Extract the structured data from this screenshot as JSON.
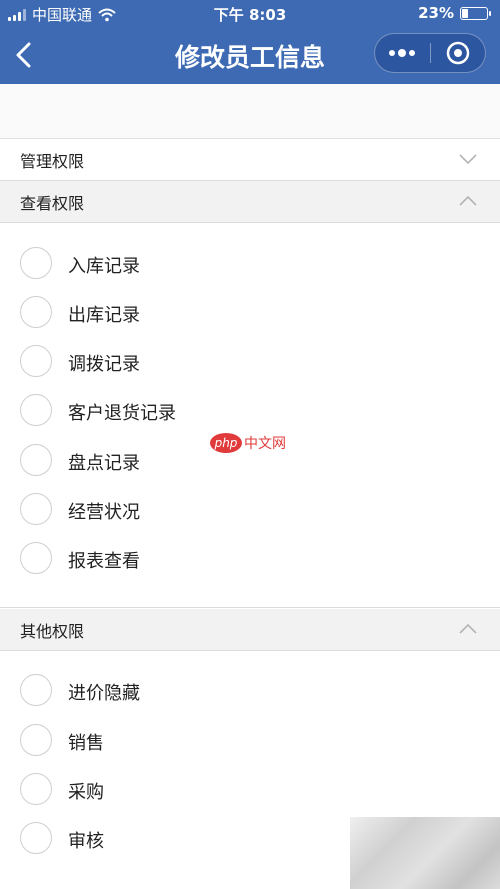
{
  "status_bar": {
    "carrier": "中国联通",
    "time": "下午 8:03",
    "battery_percent": "23%",
    "battery_level": 0.23
  },
  "nav": {
    "title": "修改员工信息",
    "back_icon": "chevron-left-icon",
    "menu_icon": "more-dots-icon",
    "close_icon": "target-circle-icon"
  },
  "sections": [
    {
      "title": "管理权限",
      "expanded": false,
      "options": []
    },
    {
      "title": "查看权限",
      "expanded": true,
      "options": [
        "入库记录",
        "出库记录",
        "调拨记录",
        "客户退货记录",
        "盘点记录",
        "经营状况",
        "报表查看"
      ]
    },
    {
      "title": "其他权限",
      "expanded": true,
      "options": [
        "进价隐藏",
        "销售",
        "采购",
        "审核"
      ]
    }
  ],
  "watermark": {
    "logo": "php",
    "text": "中文网"
  },
  "colors": {
    "nav_bg": "#3d6ab3",
    "section_open_bg": "#f2f2f2",
    "radio_border": "#cfcfcf"
  }
}
